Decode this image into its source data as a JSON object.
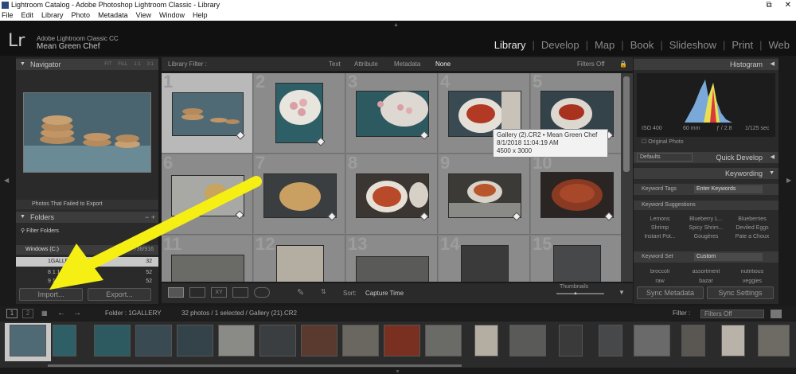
{
  "window": {
    "title": "Lightroom Catalog - Adobe Photoshop Lightroom Classic - Library"
  },
  "menu": [
    "File",
    "Edit",
    "Library",
    "Photo",
    "Metadata",
    "View",
    "Window",
    "Help"
  ],
  "identity": {
    "logo": "Lr",
    "app_name": "Adobe Lightroom Classic CC",
    "catalog_name": "Mean Green Chef"
  },
  "modules": [
    "Library",
    "Develop",
    "Map",
    "Book",
    "Slideshow",
    "Print",
    "Web"
  ],
  "active_module": "Library",
  "left_panel": {
    "navigator_title": "Navigator",
    "navigator_zoom": [
      "FIT",
      "FILL",
      "1:1",
      "3:1"
    ],
    "collection_item": "Photos That Failed to Export",
    "folders_title": "Folders",
    "filter_folders": "Filter Folders",
    "volume": {
      "name": "Windows (C:)",
      "space": "738/916"
    },
    "folders": [
      {
        "name": "1GALLERY",
        "count": "32"
      },
      {
        "name": "8 1 18",
        "count": "52"
      },
      {
        "name": "9 1 18",
        "count": "52"
      }
    ],
    "import_label": "Import...",
    "export_label": "Export..."
  },
  "filter_bar": {
    "title": "Library Filter :",
    "options": [
      "Text",
      "Attribute",
      "Metadata",
      "None"
    ],
    "active": "None",
    "filters_off": "Filters Off"
  },
  "grid": {
    "cells": [
      {
        "n": "1"
      },
      {
        "n": "2"
      },
      {
        "n": "3"
      },
      {
        "n": "4"
      },
      {
        "n": "5"
      },
      {
        "n": "6"
      },
      {
        "n": "7"
      },
      {
        "n": "8"
      },
      {
        "n": "9"
      },
      {
        "n": "10"
      },
      {
        "n": "11"
      },
      {
        "n": "12"
      },
      {
        "n": "13"
      },
      {
        "n": "14"
      },
      {
        "n": "15"
      }
    ]
  },
  "tooltip": {
    "line1": "Gallery (2).CR2 • Mean Green Chef",
    "line2": "8/1/2018 11:04:19 AM",
    "line3": "4500 x 3000"
  },
  "toolbar": {
    "sort_label": "Sort:",
    "sort_value": "Capture Time",
    "thumbnails_label": "Thumbnails"
  },
  "right_panel": {
    "histogram_title": "Histogram",
    "exif": [
      "ISO 400",
      "60 mm",
      "ƒ / 2.8",
      "1/125 sec"
    ],
    "original_photo": "Original Photo",
    "quick_develop": "Quick Develop",
    "preset": "Defaults",
    "keywording": "Keywording",
    "keyword_tags_label": "Keyword Tags",
    "keyword_tags_value": "Enter Keywords",
    "keyword_suggestions": "Keyword Suggestions",
    "suggestions": [
      "Lemons",
      "Blueberry L...",
      "Blueberries",
      "Shrimp",
      "Spicy Shrim...",
      "Deviled Eggs",
      "Instant Pot...",
      "Gougères",
      "Pate a Choux"
    ],
    "keyword_set_label": "Keyword Set",
    "keyword_set_value": "Custom",
    "keyword_set": [
      "broccoli",
      "assortment",
      "nutritious",
      "raw",
      "bazar",
      "veggies"
    ],
    "sync_metadata": "Sync Metadata",
    "sync_settings": "Sync Settings"
  },
  "filmstrip_bar": {
    "page1": "1",
    "page2": "2",
    "folder_text": "Folder : 1GALLERY",
    "photo_count": "32 photos / 1 selected / Gallery (21).CR2",
    "filter_label": "Filter :",
    "filter_value": "Filters Off"
  },
  "colors": {
    "selected_cell": "#b9b9b9",
    "grid_bg": "#7c7c7c",
    "panel": "#2a2a2a"
  }
}
